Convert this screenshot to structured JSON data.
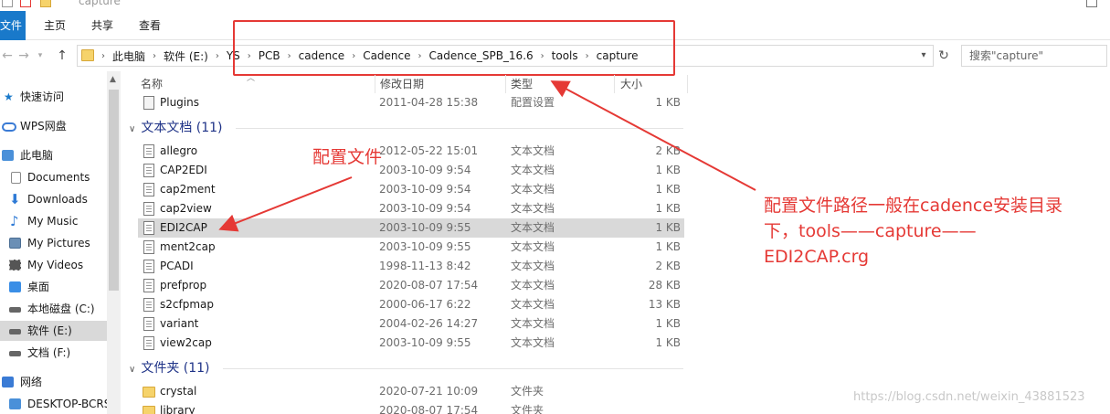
{
  "window": {
    "title": "capture"
  },
  "ribbon": {
    "tabs": [
      "文件",
      "主页",
      "共享",
      "查看"
    ]
  },
  "address": {
    "crumbs": [
      "此电脑",
      "软件 (E:)",
      "YS",
      "PCB",
      "cadence",
      "Cadence",
      "Cadence_SPB_16.6",
      "tools",
      "capture"
    ],
    "search_placeholder": "搜索\"capture\""
  },
  "sidebar": {
    "items": [
      {
        "label": "快速访问",
        "icon": "star-icon",
        "color": "#1979ca"
      },
      {
        "label": "WPS网盘",
        "icon": "cloud-icon",
        "color": "#3a7bd5"
      },
      {
        "label": "此电脑",
        "icon": "pc-icon",
        "color": "#4a90d9"
      },
      {
        "label": "Documents",
        "icon": "document-icon",
        "color": "#8a8a8a"
      },
      {
        "label": "Downloads",
        "icon": "download-icon",
        "color": "#2f7bd6"
      },
      {
        "label": "My Music",
        "icon": "music-icon",
        "color": "#2f7bd6"
      },
      {
        "label": "My Pictures",
        "icon": "picture-icon",
        "color": "#6b8fb5"
      },
      {
        "label": "My Videos",
        "icon": "video-icon",
        "color": "#555555"
      },
      {
        "label": "桌面",
        "icon": "desktop-icon",
        "color": "#3a8ee6"
      },
      {
        "label": "本地磁盘 (C:)",
        "icon": "drive-icon",
        "color": "#666666"
      },
      {
        "label": "软件 (E:)",
        "icon": "drive-icon",
        "color": "#666666"
      },
      {
        "label": "文档 (F:)",
        "icon": "drive-icon",
        "color": "#666666"
      },
      {
        "label": "网络",
        "icon": "network-icon",
        "color": "#3a7bd5"
      },
      {
        "label": "DESKTOP-BCRS",
        "icon": "computer-icon",
        "color": "#4a90d9"
      }
    ],
    "selected_index": 10
  },
  "columns": {
    "name": "名称",
    "date": "修改日期",
    "type": "类型",
    "size": "大小"
  },
  "top_file": {
    "name": "Plugins",
    "date": "2011-04-28 15:38",
    "type": "配置设置",
    "size": "1 KB"
  },
  "groups": {
    "docs": {
      "label": "文本文档 (11)"
    },
    "folders": {
      "label": "文件夹 (11)"
    }
  },
  "doc_files": [
    {
      "name": "allegro",
      "date": "2012-05-22 15:01",
      "type": "文本文档",
      "size": "2 KB"
    },
    {
      "name": "CAP2EDI",
      "date": "2003-10-09 9:54",
      "type": "文本文档",
      "size": "1 KB"
    },
    {
      "name": "cap2ment",
      "date": "2003-10-09 9:54",
      "type": "文本文档",
      "size": "1 KB"
    },
    {
      "name": "cap2view",
      "date": "2003-10-09 9:54",
      "type": "文本文档",
      "size": "1 KB"
    },
    {
      "name": "EDI2CAP",
      "date": "2003-10-09 9:55",
      "type": "文本文档",
      "size": "1 KB"
    },
    {
      "name": "ment2cap",
      "date": "2003-10-09 9:55",
      "type": "文本文档",
      "size": "1 KB"
    },
    {
      "name": "PCADI",
      "date": "1998-11-13 8:42",
      "type": "文本文档",
      "size": "2 KB"
    },
    {
      "name": "prefprop",
      "date": "2020-08-07 17:54",
      "type": "文本文档",
      "size": "28 KB"
    },
    {
      "name": "s2cfpmap",
      "date": "2000-06-17 6:22",
      "type": "文本文档",
      "size": "13 KB"
    },
    {
      "name": "variant",
      "date": "2004-02-26 14:27",
      "type": "文本文档",
      "size": "1 KB"
    },
    {
      "name": "view2cap",
      "date": "2003-10-09 9:55",
      "type": "文本文档",
      "size": "1 KB"
    }
  ],
  "selected_doc_index": 4,
  "folder_files": [
    {
      "name": "crystal",
      "date": "2020-07-21 10:09",
      "type": "文件夹",
      "size": ""
    },
    {
      "name": "library",
      "date": "2020-08-07 17:54",
      "type": "文件夹",
      "size": ""
    }
  ],
  "annotations": {
    "config_label": "配置文件",
    "path_note": [
      "配置文件路径一般在cadence安装目录",
      "下，tools——capture——",
      "EDI2CAP.crg"
    ],
    "color": "#e53935"
  },
  "watermark": "https://blog.csdn.net/weixin_43881523"
}
